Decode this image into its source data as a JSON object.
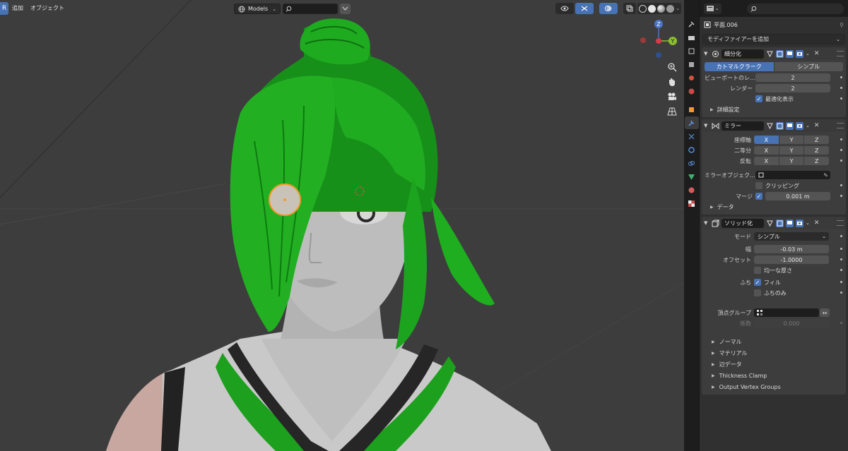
{
  "viewport": {
    "mode_chip": "R",
    "menu": [
      "追加",
      "オブジェクト"
    ],
    "collection_dropdown": "Models",
    "gizmo_axes": {
      "x": "X",
      "y": "Y",
      "z": "Z"
    },
    "icons": {
      "collection": "globe-icon",
      "search": "search-icon",
      "filter": "filter-icon",
      "visibility": "eye-icon",
      "gizmo": "gizmo-icon",
      "overlay": "overlay-icon",
      "xray": "xray-icon",
      "zoom": "zoom-icon",
      "pan": "hand-icon",
      "camera": "camera-icon",
      "perspective": "grid-icon"
    },
    "colors": {
      "background": "#3d3d3d",
      "hair": "#1faa1f",
      "skin": "#bdbdbd",
      "accent": "#4772b3"
    }
  },
  "sidebar_tabs": [
    "tool",
    "render",
    "output",
    "view-layer",
    "scene",
    "world",
    "object",
    "modifiers",
    "particles",
    "physics",
    "constraints",
    "data",
    "material",
    "texture"
  ],
  "properties": {
    "object_name": "平面.006",
    "add_modifier": "モディファイアーを追加",
    "subdivision": {
      "name": "細分化",
      "algorithms": [
        "カトマルクラーク",
        "シンプル"
      ],
      "active_algorithm": 0,
      "viewport_label": "ビューポートのレ...",
      "viewport_value": "2",
      "render_label": "レンダー",
      "render_value": "2",
      "optimal_label": "最適化表示",
      "advanced": "詳細設定"
    },
    "mirror": {
      "name": "ミラー",
      "axis_label": "座標軸",
      "bisect_label": "二等分",
      "flip_label": "反転",
      "axes": [
        "X",
        "Y",
        "Z"
      ],
      "mirror_object_label": "ミラーオブジェク...",
      "clipping_label": "クリッピング",
      "merge_label": "マージ",
      "merge_value": "0.001 m",
      "data": "データ"
    },
    "solidify": {
      "name": "ソリッド化",
      "mode_label": "モード",
      "mode_value": "シンプル",
      "thickness_label": "幅",
      "thickness_value": "-0.03 m",
      "offset_label": "オフセット",
      "offset_value": "-1.0000",
      "even_label": "均一な厚さ",
      "rim_label": "ふち",
      "fill_label": "フィル",
      "rim_only_label": "ふちのみ",
      "vgroup_label": "頂点グループ",
      "factor_label": "係数",
      "factor_value": "0.000",
      "subpanels": [
        "ノーマル",
        "マテリアル",
        "辺データ",
        "Thickness Clamp",
        "Output Vertex Groups"
      ]
    }
  }
}
